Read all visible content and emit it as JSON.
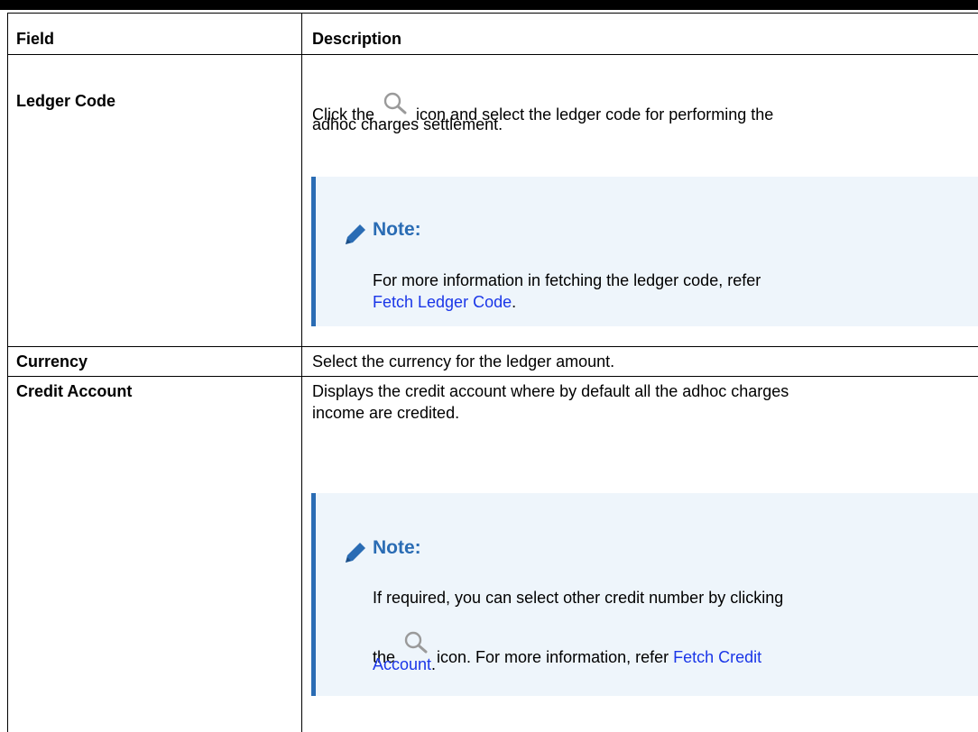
{
  "table": {
    "header": {
      "field": "Field",
      "description": "Description"
    },
    "rows": [
      {
        "field": "Ledger Code",
        "desc_before_icon": "Click the",
        "desc_after_icon": "icon and select the ledger code for performing the",
        "desc_line2": "adhoc charges settlement.",
        "icon": "search-icon",
        "note": {
          "title": "Note:",
          "line1": "For more information in fetching the ledger code, refer",
          "link": "Fetch Ledger Code",
          "after_link": "."
        }
      },
      {
        "field": "Currency",
        "desc": "Select the currency for the ledger amount."
      },
      {
        "field": "Credit Account",
        "desc_line1": "Displays the credit account where by default all the adhoc charges",
        "desc_line2": "income are credited.",
        "note": {
          "title": "Note:",
          "line1": "If required, you can select other credit number by clicking",
          "line2_before_icon": "the",
          "line2_after_icon": "icon. For more information, refer",
          "link_part1": "Fetch Credit",
          "link_part2": "Account",
          "after_link": ".",
          "icon": "search-icon"
        }
      }
    ]
  },
  "colors": {
    "note_accent": "#2a6cb4",
    "note_bg": "#eef5fb",
    "link": "#1a36e8"
  }
}
